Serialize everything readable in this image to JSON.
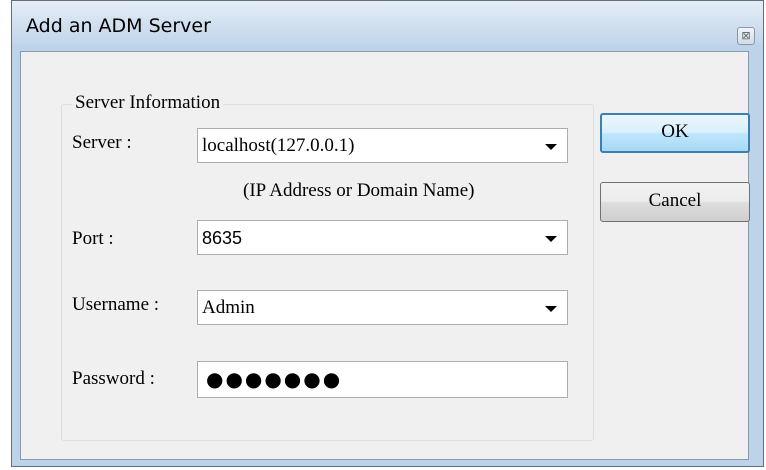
{
  "window": {
    "title": "Add an ADM Server",
    "close_glyph": "⊠",
    "close_icon": "close-icon"
  },
  "group": {
    "legend": "Server Information"
  },
  "fields": {
    "server": {
      "label": "Server :",
      "value": "localhost(127.0.0.1)",
      "hint": "(IP Address or Domain Name)"
    },
    "port": {
      "label": "Port :",
      "value": "8635"
    },
    "username": {
      "label": "Username :",
      "value": "Admin"
    },
    "password": {
      "label": "Password :",
      "masked_value": "●●●●●●●"
    }
  },
  "buttons": {
    "ok": "OK",
    "cancel": "Cancel"
  },
  "colors": {
    "title_bar": "#c2d5ea",
    "client_bg": "#f0f0f0",
    "default_button_border": "#3c7fb1"
  }
}
